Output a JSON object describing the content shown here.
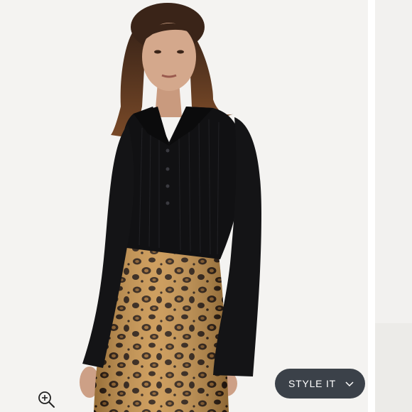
{
  "colors": {
    "background": "#f4f3f1",
    "button_bg": "#3b4149",
    "button_text": "#ffffff",
    "top_color": "#111113",
    "skirt_base": "#c8924a"
  },
  "icons": {
    "zoom": "zoom-in-icon",
    "chevron": "chevron-down-icon"
  },
  "actions": {
    "style_it_label": "STYLE IT"
  }
}
